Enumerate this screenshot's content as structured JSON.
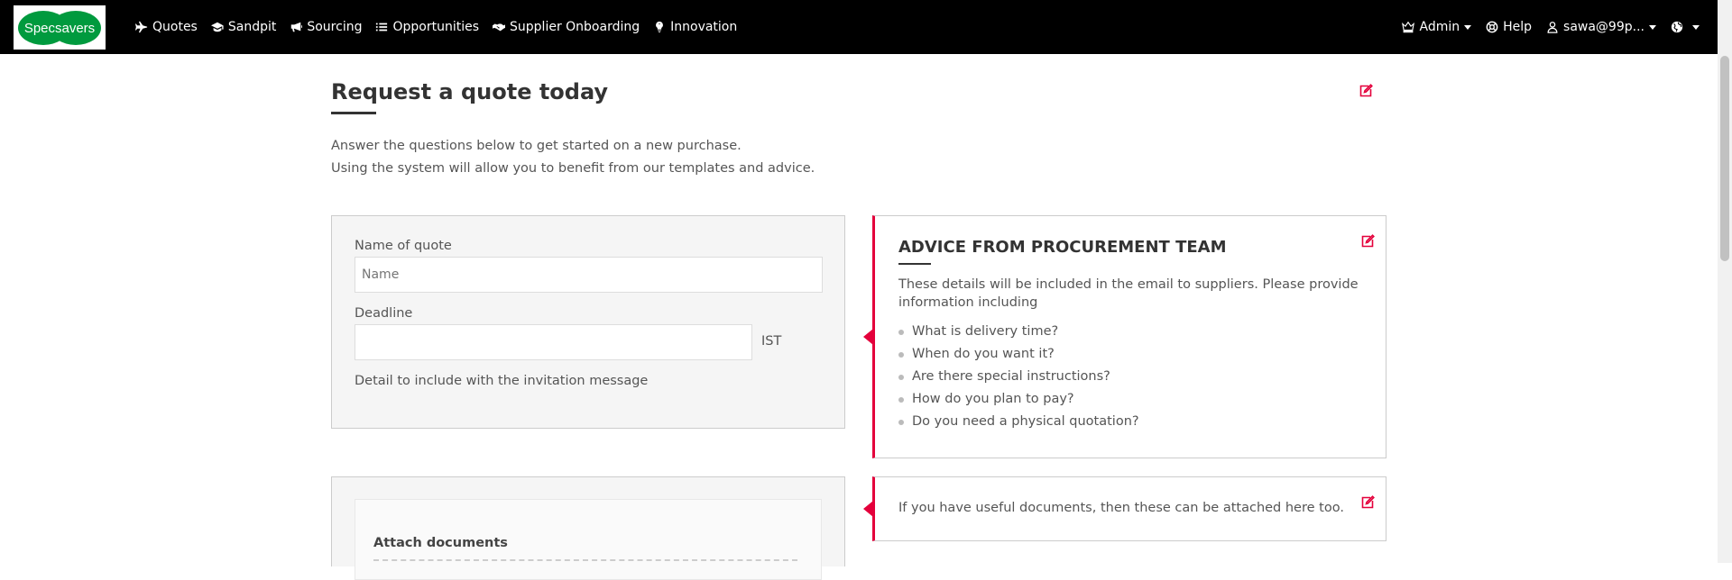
{
  "brand": {
    "logo_text": "Specsavers",
    "brand_green": "#009a3e",
    "accent": "#e4003b"
  },
  "nav": {
    "left": [
      {
        "label": "Quotes",
        "icon": "plane-icon"
      },
      {
        "label": "Sandpit",
        "icon": "graduation-cap-icon"
      },
      {
        "label": "Sourcing",
        "icon": "bullhorn-icon"
      },
      {
        "label": "Opportunities",
        "icon": "list-icon"
      },
      {
        "label": "Supplier Onboarding",
        "icon": "handshake-icon"
      },
      {
        "label": "Innovation",
        "icon": "lightbulb-icon"
      }
    ],
    "admin_label": "Admin",
    "help_label": "Help",
    "user_label": "sawa@99p..."
  },
  "page": {
    "title": "Request a quote today",
    "intro_line1": "Answer the questions below to get started on a new purchase.",
    "intro_line2": "Using the system will allow you to benefit from our templates and advice."
  },
  "form": {
    "name_label": "Name of quote",
    "name_placeholder": "Name",
    "name_value": "",
    "deadline_label": "Deadline",
    "deadline_value": "",
    "timezone": "IST",
    "detail_label": "Detail to include with the invitation message"
  },
  "advice": {
    "title": "ADVICE FROM PROCUREMENT TEAM",
    "text": "These details will be included in the email to suppliers. Please provide information including",
    "items": [
      "What is delivery time?",
      "When do you want it?",
      "Are there special instructions?",
      "How do you plan to pay?",
      "Do you need a physical quotation?"
    ]
  },
  "attach": {
    "label": "Attach documents",
    "advice_text": "If you have useful documents, then these can be attached here too."
  }
}
